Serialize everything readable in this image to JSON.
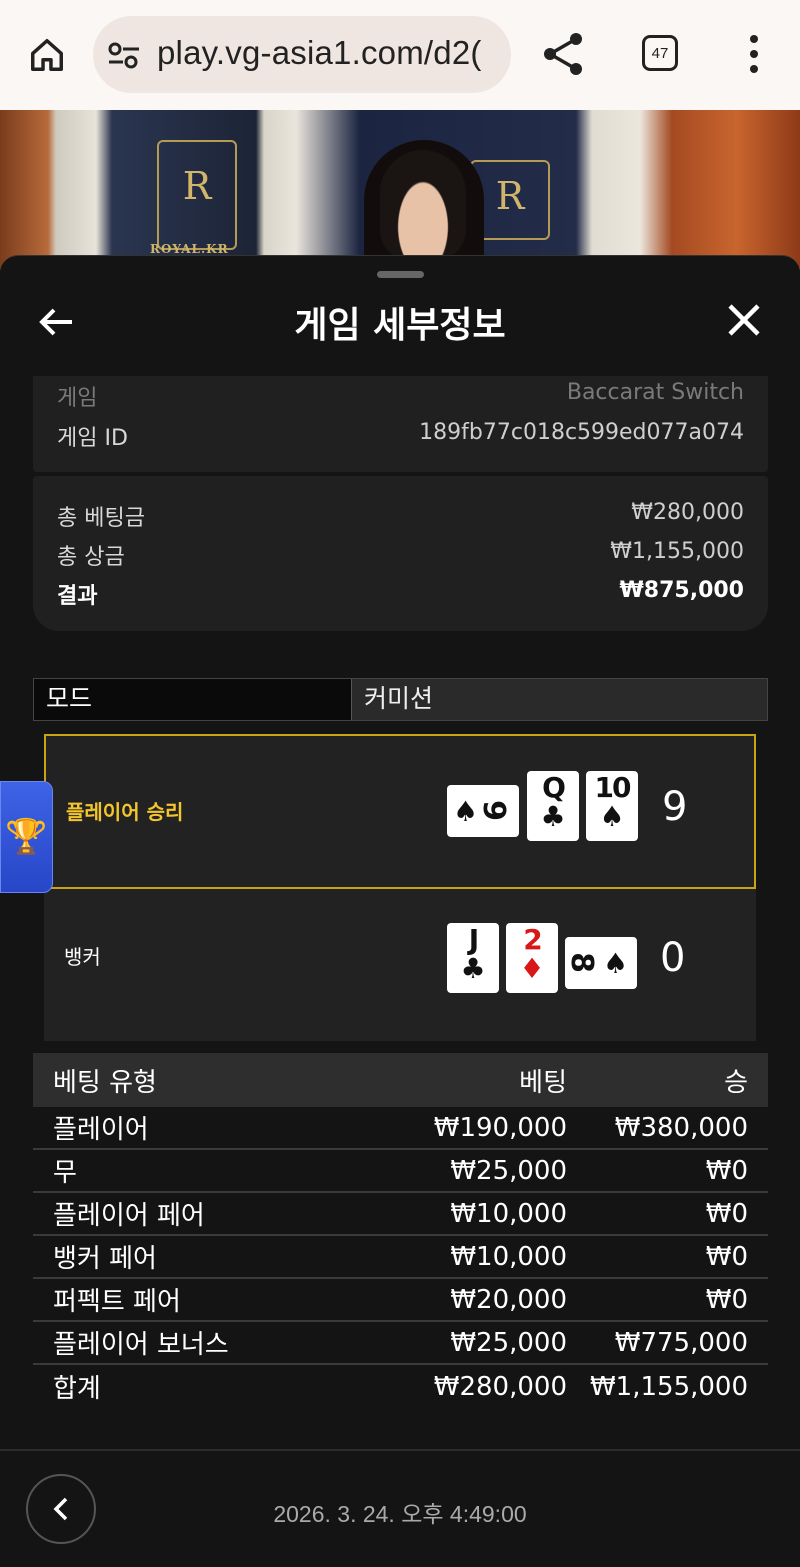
{
  "browser": {
    "url": "play.vg-asia1.com/d2(",
    "tab_count": "47"
  },
  "video": {
    "logo_letter": "R",
    "logo_text": "ROYAL.KR"
  },
  "sheet": {
    "title": "게임 세부정보",
    "game_label": "게임",
    "game_value": "Baccarat Switch",
    "game_id_label": "게임 ID",
    "game_id_value": "189fb77c018c599ed077a074",
    "total_bet_label": "총 베팅금",
    "total_bet_value": "₩280,000",
    "total_win_label": "총 상금",
    "total_win_value": "₩1,155,000",
    "result_label": "결과",
    "result_value": "₩875,000"
  },
  "mode": {
    "left": "모드",
    "right": "커미션"
  },
  "result": {
    "player_label": "플레이어 승리",
    "player_score": "9",
    "player_cards": [
      {
        "rank": "9",
        "suit": "♠",
        "orientation": "horizontal",
        "color": "black"
      },
      {
        "rank": "Q",
        "suit": "♣",
        "orientation": "vertical",
        "color": "black"
      },
      {
        "rank": "10",
        "suit": "♠",
        "orientation": "vertical",
        "color": "black"
      }
    ],
    "banker_label": "뱅커",
    "banker_score": "0",
    "banker_cards": [
      {
        "rank": "J",
        "suit": "♣",
        "orientation": "vertical",
        "color": "black"
      },
      {
        "rank": "2",
        "suit": "♦",
        "orientation": "vertical",
        "color": "red"
      },
      {
        "rank": "8",
        "suit": "♠",
        "orientation": "horizontal",
        "color": "black"
      }
    ],
    "win_color": "#f2c62c"
  },
  "bets": {
    "headers": [
      "베팅 유형",
      "베팅",
      "승"
    ],
    "rows": [
      [
        "플레이어",
        "₩190,000",
        "₩380,000"
      ],
      [
        "무",
        "₩25,000",
        "₩0"
      ],
      [
        "플레이어 페어",
        "₩10,000",
        "₩0"
      ],
      [
        "뱅커 페어",
        "₩10,000",
        "₩0"
      ],
      [
        "퍼펙트 페어",
        "₩20,000",
        "₩0"
      ],
      [
        "플레이어 보너스",
        "₩25,000",
        "₩775,000"
      ],
      [
        "합계",
        "₩280,000",
        "₩1,155,000"
      ]
    ]
  },
  "footer": {
    "date": "2026. 3. 24. 오후 4:49:00"
  },
  "icons": [
    "home-icon",
    "tune-icon",
    "share-icon",
    "tabs-icon",
    "more-vert-icon",
    "back-arrow-icon",
    "close-icon",
    "trophy-icon",
    "chevron-left-icon"
  ]
}
